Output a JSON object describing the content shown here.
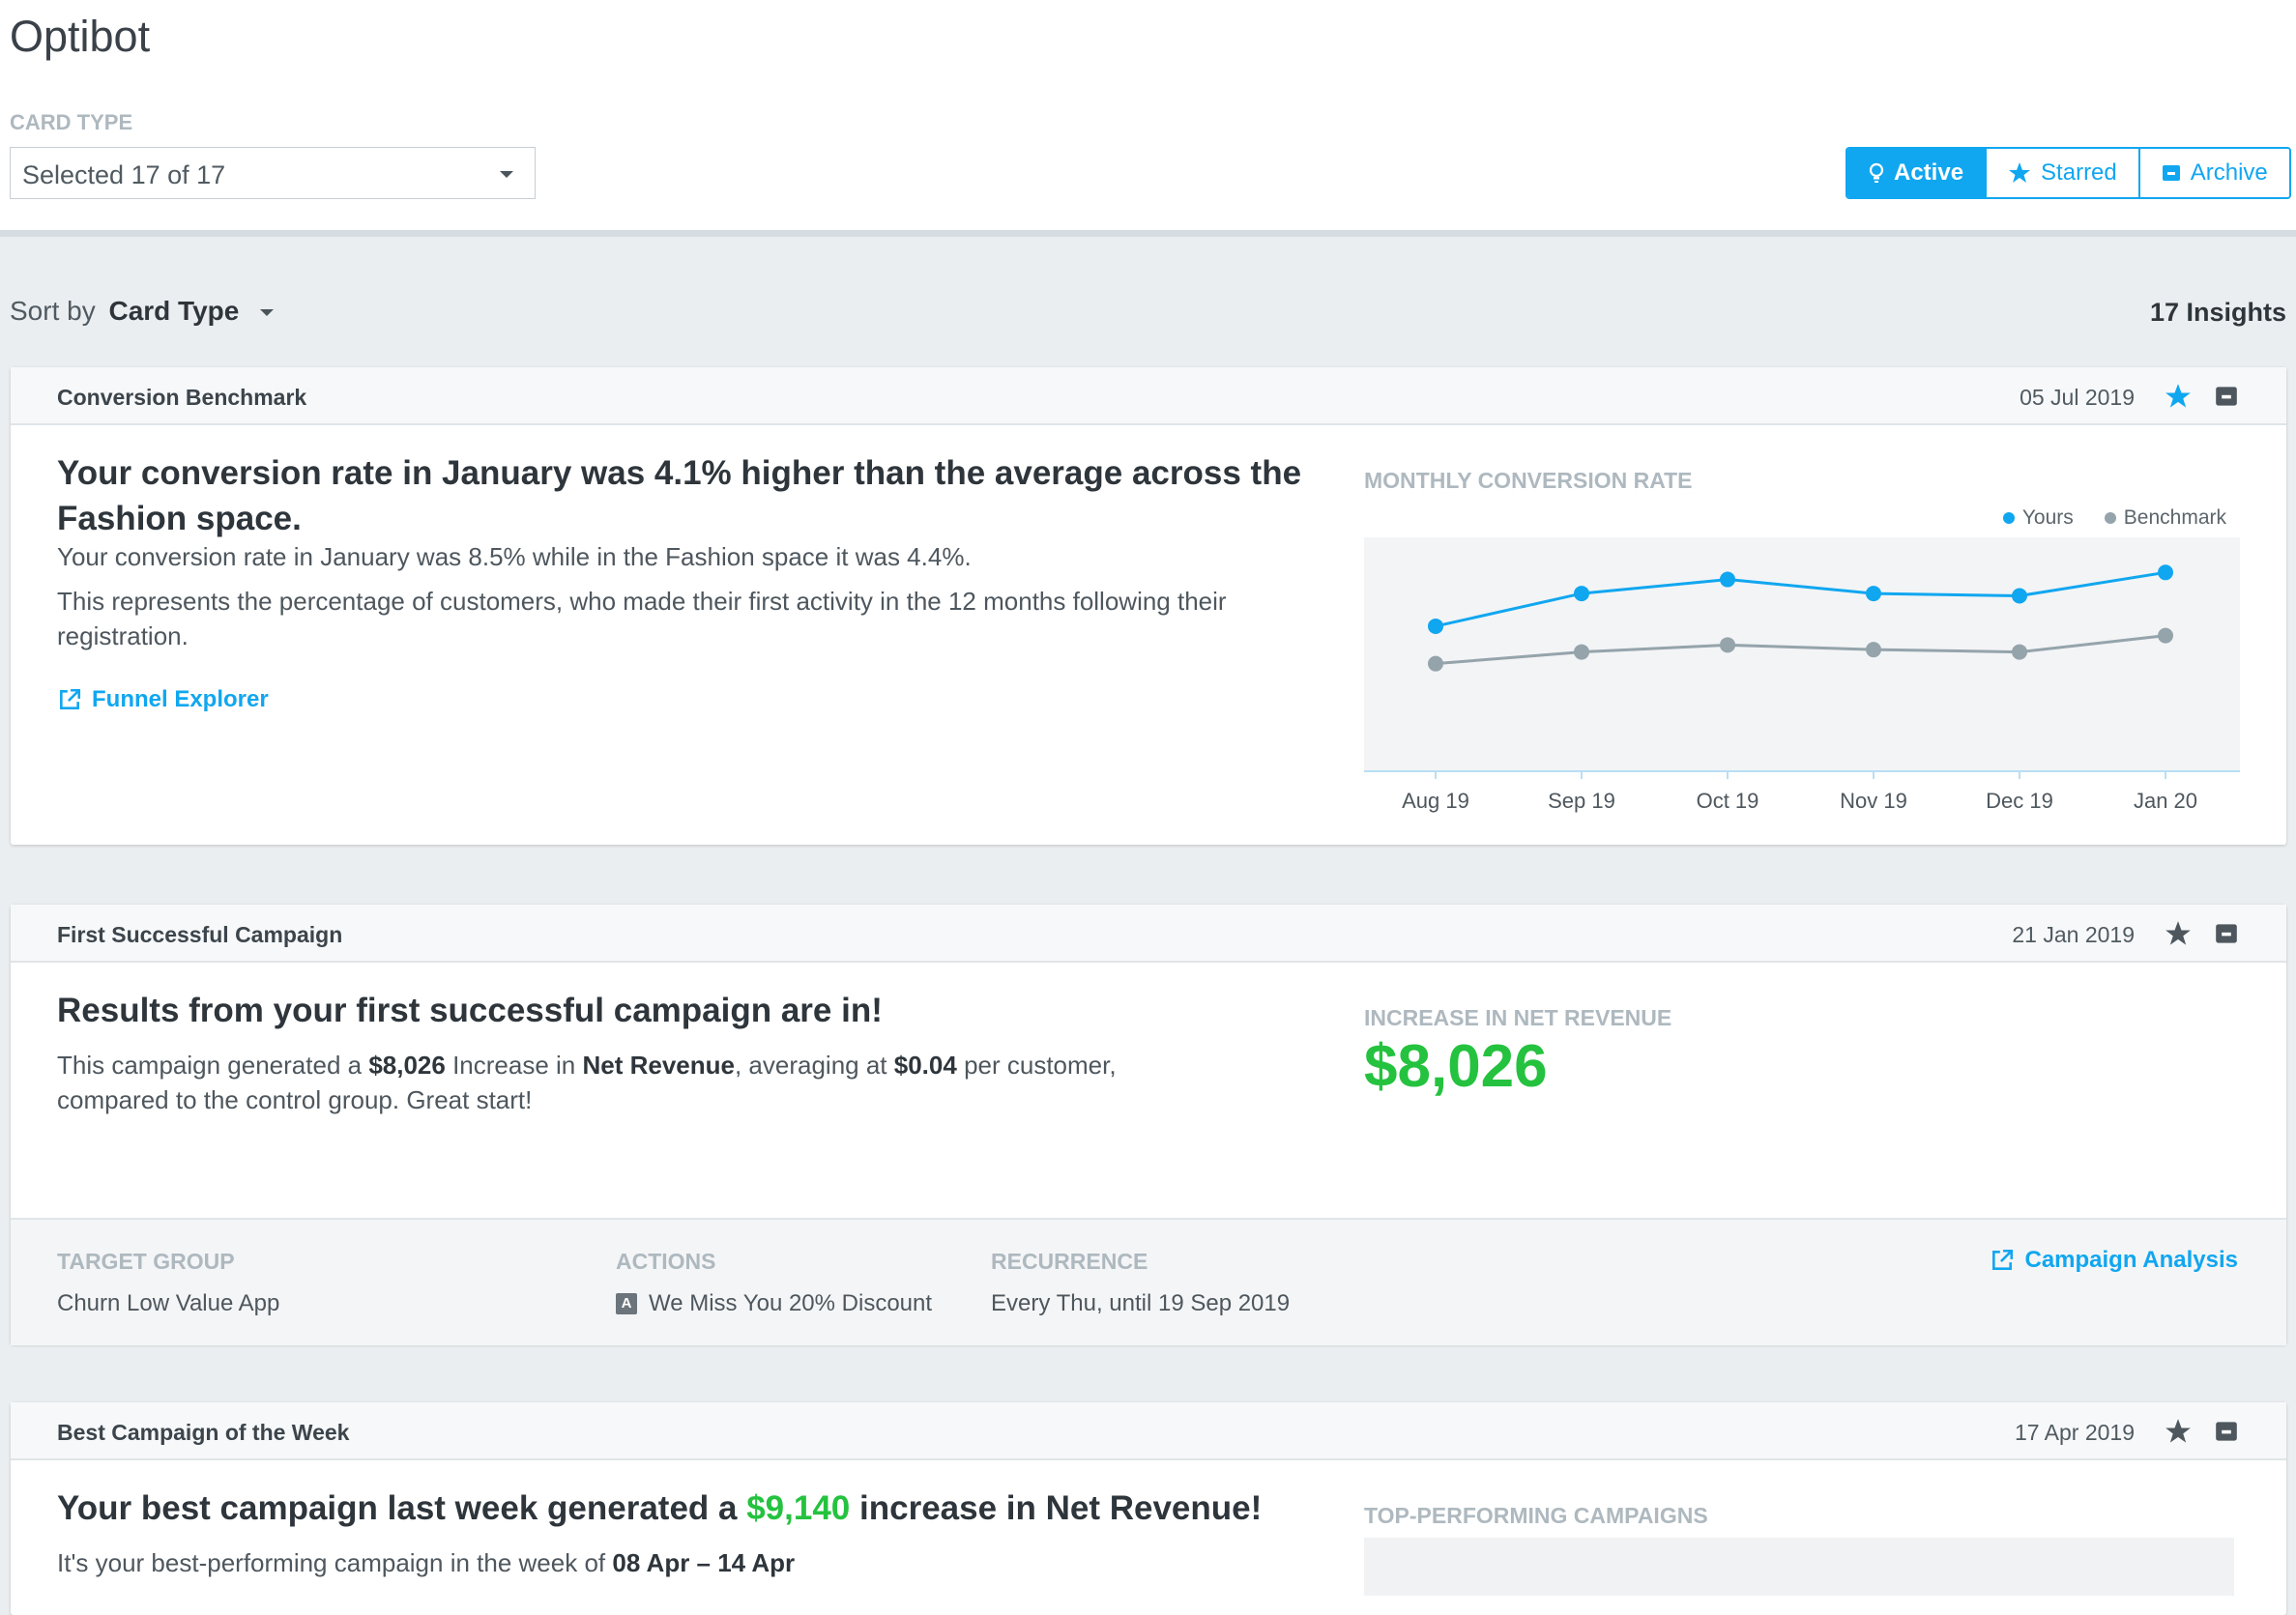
{
  "app": {
    "title": "Optibot"
  },
  "filter": {
    "label": "CARD TYPE",
    "selected": "Selected 17 of 17"
  },
  "view_toggle": {
    "active": "Active",
    "starred": "Starred",
    "archive": "Archive"
  },
  "sort": {
    "prefix": "Sort by",
    "value": "Card Type"
  },
  "insights_count": "17 Insights",
  "colors": {
    "accent": "#11a6f0",
    "positive": "#25c23f",
    "benchmark": "#95a3ab"
  },
  "cards": [
    {
      "type": "Conversion Benchmark",
      "date": "05 Jul 2019",
      "headline": "Your conversion rate in January was 4.1% higher than the average across the Fashion space.",
      "line1": "Your conversion rate in January was 8.5% while in the Fashion space it was 4.4%.",
      "line2": "This represents the percentage of customers, who made their first activity in the 12 months following their registration.",
      "link": "Funnel Explorer",
      "chart_title": "MONTHLY CONVERSION RATE"
    },
    {
      "type": "First Successful Campaign",
      "date": "21 Jan 2019",
      "headline": "Results from your first successful campaign are in!",
      "body": {
        "t1": "This campaign generated a ",
        "v1": "$8,026",
        "t2": " Increase in ",
        "v2": "Net Revenue",
        "t3": ", averaging at ",
        "v3": "$0.04",
        "t4": " per customer, compared to the control group. Great start!"
      },
      "metric_label": "INCREASE IN NET REVENUE",
      "metric_value": "$8,026",
      "footer": {
        "target_group_label": "TARGET GROUP",
        "target_group": "Churn Low Value App",
        "actions_label": "ACTIONS",
        "action_badge": "A",
        "action": "We Miss You 20% Discount",
        "recurrence_label": "RECURRENCE",
        "recurrence": "Every Thu, until 19 Sep 2019",
        "link": "Campaign Analysis"
      }
    },
    {
      "type": "Best Campaign of the Week",
      "date": "17 Apr 2019",
      "headline_pre": "Your best campaign last week generated a ",
      "headline_value": "$9,140",
      "headline_post": " increase in Net Revenue!",
      "sub_pre": "It's your best-performing campaign in the week of ",
      "sub_value": "08 Apr – 14 Apr",
      "section_label": "TOP-PERFORMING CAMPAIGNS"
    }
  ],
  "chart_data": {
    "type": "line",
    "title": "MONTHLY CONVERSION RATE",
    "categories": [
      "Aug 19",
      "Sep 19",
      "Oct 19",
      "Nov 19",
      "Dec 19",
      "Jan 20"
    ],
    "series": [
      {
        "name": "Yours",
        "color": "#11a6f0",
        "values": [
          6.2,
          7.6,
          8.2,
          7.6,
          7.5,
          8.5
        ]
      },
      {
        "name": "Benchmark",
        "color": "#95a3ab",
        "values": [
          4.6,
          5.1,
          5.4,
          5.2,
          5.1,
          5.8
        ]
      }
    ],
    "ylim": [
      0,
      10
    ],
    "grid": false,
    "legend": "top-right"
  }
}
